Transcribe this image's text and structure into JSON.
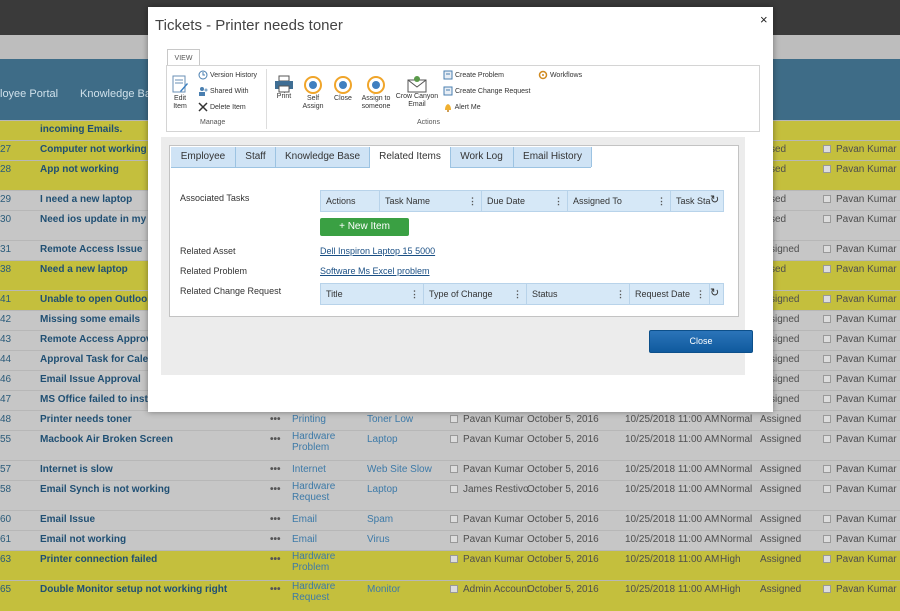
{
  "background": {
    "nav": [
      "loyee Portal",
      "Knowledge Ba"
    ],
    "rows": [
      {
        "id": "",
        "title": "incoming Emails.",
        "hl": true
      },
      {
        "id": "27",
        "title": "Computer not working",
        "hl": true,
        "status": "sed",
        "owner": "Pavan Kumar"
      },
      {
        "id": "28",
        "title": "App not working",
        "hl": true,
        "status": "sed",
        "owner": "Pavan Kumar"
      },
      {
        "id": "29",
        "title": "I need a new laptop",
        "hl": false,
        "status": "sed",
        "owner": "Pavan Kumar"
      },
      {
        "id": "30",
        "title": "Need ios update in my Ipl",
        "hl": false,
        "status": "sed",
        "owner": "Pavan Kumar"
      },
      {
        "id": "31",
        "title": "Remote Access Issue",
        "hl": false,
        "status": "signed",
        "owner": "Pavan Kumar"
      },
      {
        "id": "38",
        "title": "Need a new laptop",
        "hl": true,
        "status": "sed",
        "owner": "Pavan Kumar"
      },
      {
        "id": "41",
        "title": "Unable to open Outlook i",
        "hl": true,
        "status": "signed",
        "owner": "Pavan Kumar"
      },
      {
        "id": "42",
        "title": "Missing some emails",
        "hl": false,
        "status": "signed",
        "owner": "Pavan Kumar"
      },
      {
        "id": "43",
        "title": "Remote Access Approval T",
        "hl": false,
        "status": "signed",
        "owner": "Pavan Kumar"
      },
      {
        "id": "44",
        "title": "Approval Task for Calenda",
        "hl": false,
        "status": "signed",
        "owner": "Pavan Kumar"
      },
      {
        "id": "46",
        "title": "Email Issue Approval",
        "hl": false,
        "status": "signed",
        "owner": "Pavan Kumar"
      },
      {
        "id": "47",
        "title": "MS Office failed to install",
        "hl": false,
        "status": "signed",
        "owner": "Pavan Kumar"
      },
      {
        "id": "48",
        "title": "Printer needs toner",
        "hl": false,
        "cat": "Printing",
        "sub": "Toner Low",
        "assign": "Pavan Kumar",
        "created": "October 5, 2016",
        "due": "10/25/2018 11:00 AM",
        "prio": "Normal",
        "status": "Assigned",
        "owner": "Pavan Kumar"
      },
      {
        "id": "55",
        "title": "Macbook Air Broken Screen",
        "hl": false,
        "cat": "Hardware Problem",
        "sub": "Laptop",
        "assign": "Pavan Kumar",
        "created": "October 5, 2016",
        "due": "10/25/2018 11:00 AM",
        "prio": "Normal",
        "status": "Assigned",
        "owner": "Pavan Kumar"
      },
      {
        "id": "57",
        "title": "Internet is slow",
        "hl": false,
        "cat": "Internet",
        "sub": "Web Site Slow",
        "assign": "Pavan Kumar",
        "created": "October 5, 2016",
        "due": "10/25/2018 11:00 AM",
        "prio": "Normal",
        "status": "Assigned",
        "owner": "Pavan Kumar"
      },
      {
        "id": "58",
        "title": "Email Synch is not working",
        "hl": false,
        "cat": "Hardware Request",
        "sub": "Laptop",
        "assign": "James Restivo",
        "created": "October 5, 2016",
        "due": "10/25/2018 11:00 AM",
        "prio": "Normal",
        "status": "Assigned",
        "owner": "Pavan Kumar"
      },
      {
        "id": "60",
        "title": "Email Issue",
        "hl": false,
        "cat": "Email",
        "sub": "Spam",
        "assign": "Pavan Kumar",
        "created": "October 5, 2016",
        "due": "10/25/2018 11:00 AM",
        "prio": "Normal",
        "status": "Assigned",
        "owner": "Pavan Kumar"
      },
      {
        "id": "61",
        "title": "Email not working",
        "hl": false,
        "cat": "Email",
        "sub": "Virus",
        "assign": "Pavan Kumar",
        "created": "October 5, 2016",
        "due": "10/25/2018 11:00 AM",
        "prio": "Normal",
        "status": "Assigned",
        "owner": "Pavan Kumar"
      },
      {
        "id": "63",
        "title": "Printer connection failed",
        "hl": true,
        "cat": "Hardware Problem",
        "sub": "",
        "assign": "Pavan Kumar",
        "created": "October 5, 2016",
        "due": "10/25/2018 11:00 AM",
        "prio": "High",
        "status": "Assigned",
        "owner": "Pavan Kumar"
      },
      {
        "id": "65",
        "title": "Double Monitor setup not working right",
        "hl": true,
        "cat": "Hardware Request",
        "sub": "Monitor",
        "assign": "Admin Account",
        "created": "October 5, 2016",
        "due": "10/25/2018 11:00 AM",
        "prio": "High",
        "status": "Assigned",
        "owner": "Pavan Kumar"
      }
    ]
  },
  "dialog": {
    "title": "Tickets - Printer needs toner",
    "close_x": "×",
    "ribbon": {
      "tab": "VIEW",
      "manage_group": "Manage",
      "actions_group": "Actions",
      "edit_item": [
        "Edit",
        "Item"
      ],
      "version_history": "Version History",
      "shared_with": "Shared With",
      "delete_item": "Delete Item",
      "print": "Print",
      "self_assign": [
        "Self",
        "Assign"
      ],
      "close": "Close",
      "assign_to_someone": [
        "Assign to",
        "someone"
      ],
      "crow_canyon_email": [
        "Crow Canyon",
        "Email"
      ],
      "create_problem": "Create Problem",
      "create_change_request": "Create Change Request",
      "alert_me": "Alert Me",
      "workflows": "Workflows"
    },
    "tabs": [
      "Employee",
      "Staff",
      "Knowledge Base",
      "Related Items",
      "Work Log",
      "Email History"
    ],
    "active_tab": "Related Items",
    "fields": {
      "associated_tasks_label": "Associated Tasks",
      "tasks_columns": [
        "Actions",
        "Task Name",
        "Due Date",
        "Assigned To",
        "Task Sta"
      ],
      "new_item": "New Item",
      "related_asset_label": "Related Asset",
      "related_asset_value": "Dell Inspiron Laptop 15 5000",
      "related_problem_label": "Related Problem",
      "related_problem_value": "Software Ms Excel problem",
      "related_cr_label": "Related Change Request",
      "cr_columns": [
        "Title",
        "Type of Change",
        "Status",
        "Request Date"
      ]
    },
    "close_button": "Close"
  }
}
